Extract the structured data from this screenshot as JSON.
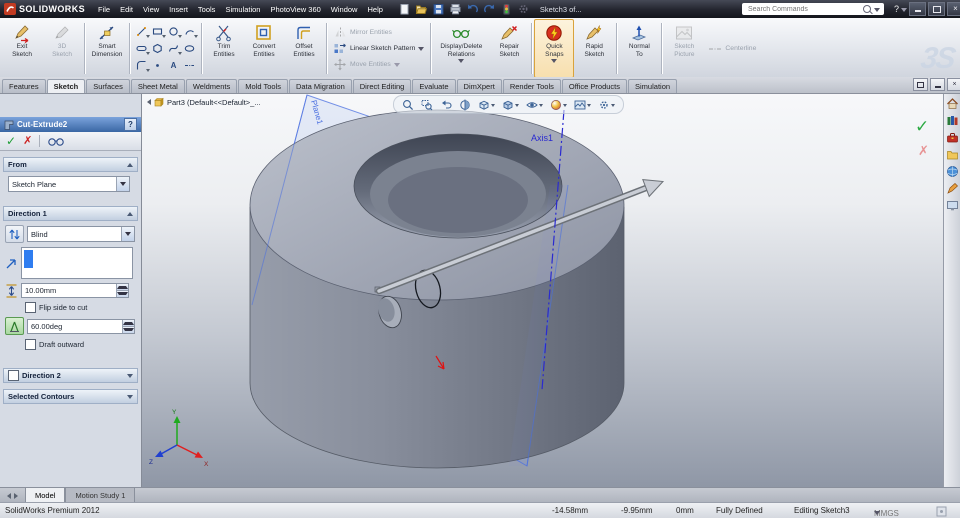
{
  "colors": {
    "pm_header_blue": "#3a67a4",
    "plane_blue": "#4a6fe0",
    "axis_blue": "#2a2ad0",
    "check_green": "#2daa44",
    "cross_red": "#dd3333",
    "quick_snaps_highlight": "#d9a33c"
  },
  "icons": {
    "check": "✓",
    "cross": "✗",
    "close": "×",
    "question": "?",
    "text_tool": "A"
  },
  "titlebar": {
    "app": "SOLIDWORKS",
    "menus": [
      "File",
      "Edit",
      "View",
      "Insert",
      "Tools",
      "Simulation",
      "PhotoView 360",
      "Window",
      "Help"
    ],
    "doc_title": "Sketch3 of...",
    "search_placeholder": "Search Commands",
    "ds_logo": "3S"
  },
  "ribbon": {
    "exit_sketch": {
      "l1": "Exit",
      "l2": "Sketch"
    },
    "sketch3d": {
      "l1": "3D",
      "l2": "Sketch"
    },
    "smart_dimension": {
      "l1": "Smart",
      "l2": "Dimension"
    },
    "trim": {
      "l1": "Trim",
      "l2": "Entities"
    },
    "convert": {
      "l1": "Convert",
      "l2": "Entities"
    },
    "offset": {
      "l1": "Offset",
      "l2": "Entities"
    },
    "mirror": "Mirror Entities",
    "linear_pattern": "Linear Sketch Pattern",
    "move": "Move Entities",
    "display_delete": {
      "l1": "Display/Delete",
      "l2": "Relations"
    },
    "repair": {
      "l1": "Repair",
      "l2": "Sketch"
    },
    "quick_snaps": {
      "l1": "Quick",
      "l2": "Snaps"
    },
    "rapid_sketch": {
      "l1": "Rapid",
      "l2": "Sketch"
    },
    "normal_to": {
      "l1": "Normal",
      "l2": "To"
    },
    "sketch_picture": {
      "l1": "Sketch",
      "l2": "Picture"
    },
    "centerline": "Centerline"
  },
  "tabs": {
    "items": [
      "Features",
      "Sketch",
      "Surfaces",
      "Sheet Metal",
      "Weldments",
      "Mold Tools",
      "Data Migration",
      "Direct Editing",
      "Evaluate",
      "DimXpert",
      "Render Tools",
      "Office Products",
      "Simulation"
    ],
    "active": "Sketch"
  },
  "pm": {
    "title": "Cut-Extrude2",
    "from": {
      "label": "From",
      "value": "Sketch Plane"
    },
    "direction1": {
      "label": "Direction 1",
      "end_condition": "Blind",
      "depth": "10.00mm",
      "flip_label": "Flip side to cut",
      "draft_angle": "60.00deg",
      "draft_outward_label": "Draft outward"
    },
    "direction2": {
      "label": "Direction 2"
    },
    "contours": {
      "label": "Selected Contours"
    }
  },
  "viewport": {
    "breadcrumb": "Part3 (Default<<Default>_...",
    "plane_label": "Plane1",
    "axis_label": "Axis1",
    "triad": {
      "x": "X",
      "y": "Y",
      "z": "Z"
    }
  },
  "bottom_tabs": {
    "model": "Model",
    "motion": "Motion Study 1"
  },
  "statusbar": {
    "product": "SolidWorks Premium 2012",
    "x": "-14.58mm",
    "y": "-9.95mm",
    "z": "0mm",
    "state": "Fully Defined",
    "editing": "Editing Sketch3",
    "units": "MMGS"
  }
}
